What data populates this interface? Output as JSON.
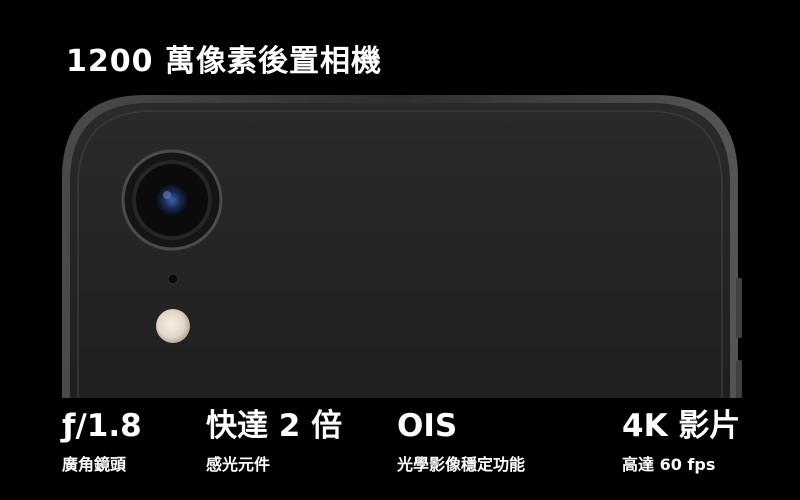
{
  "headline": "1200 萬像素後置相機",
  "specs": [
    {
      "value": "ƒ/1.8",
      "label": "廣角鏡頭"
    },
    {
      "value": "快達 2 倍",
      "label": "感光元件"
    },
    {
      "value": "OIS",
      "label": "光學影像穩定功能"
    },
    {
      "value": "4K 影片",
      "label": "高達 60 fps"
    }
  ],
  "colors": {
    "background": "#000000",
    "phone_body": "#1f1f20",
    "phone_frame": "#3b3b3d",
    "text": "#ffffff",
    "flash": "#e9ded3",
    "lens_blue": "#2b4a8a"
  }
}
